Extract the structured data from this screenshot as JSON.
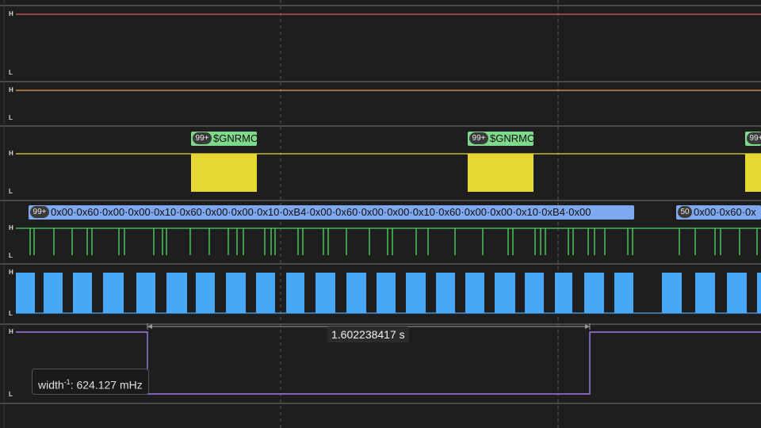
{
  "channels": [
    {
      "id": "ch1",
      "color": "#e05560",
      "high_label": "H",
      "low_label": "L"
    },
    {
      "id": "ch2",
      "color": "#e8a050",
      "high_label": "H",
      "low_label": "L"
    },
    {
      "id": "ch3",
      "color": "#e6d834",
      "high_label": "H",
      "low_label": "L"
    },
    {
      "id": "ch4",
      "color": "#4fd060",
      "high_label": "H",
      "low_label": "L"
    },
    {
      "id": "ch5",
      "color": "#49a8f5",
      "high_label": "H",
      "low_label": "L"
    },
    {
      "id": "ch6",
      "color": "#9b7ce8",
      "high_label": "H",
      "low_label": "L"
    }
  ],
  "decoders": {
    "uart": {
      "color": "#7ed98a",
      "packets": [
        {
          "count": "99+",
          "text": "$GNRMC"
        },
        {
          "count": "99+",
          "text": "$GNRMC"
        },
        {
          "count": "99+",
          "text": ""
        }
      ]
    },
    "bytes": {
      "color": "#7fa9ee",
      "packets": [
        {
          "count": "99+",
          "text": "0x00·0x60·0x00·0x00·0x10·0x60·0x00·0x00·0x10·0xB4·0x00·0x60·0x00·0x00·0x10·0x60·0x00·0x00·0x10·0xB4·0x00"
        },
        {
          "count": "50",
          "text": "0x00·0x60·0x"
        }
      ]
    }
  },
  "measurement": {
    "duration": "1.602238417 s",
    "tooltip_label": "width",
    "tooltip_exponent": "-1",
    "tooltip_value": ": 624.127 mHz"
  }
}
